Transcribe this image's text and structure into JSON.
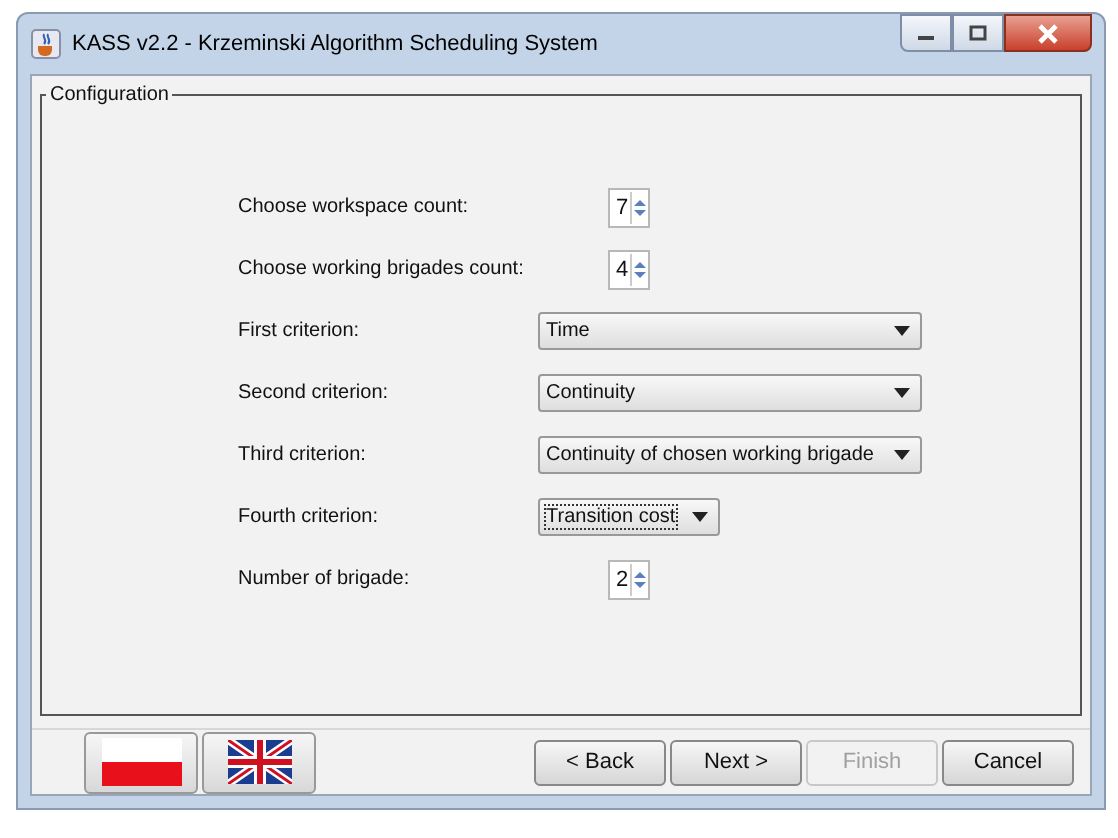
{
  "window": {
    "title": "KASS v2.2 - Krzeminski Algorithm Scheduling System"
  },
  "panel": {
    "title": "Configuration"
  },
  "rows": [
    {
      "kind": "spinner",
      "label": "Choose workspace count:",
      "value": "7"
    },
    {
      "kind": "spinner",
      "label": "Choose working brigades count:",
      "value": "4"
    },
    {
      "kind": "combo",
      "label": "First criterion:",
      "value": "Time",
      "focused": false
    },
    {
      "kind": "combo",
      "label": "Second criterion:",
      "value": "Continuity",
      "focused": false
    },
    {
      "kind": "combo",
      "label": "Third criterion:",
      "value": "Continuity of chosen working brigade",
      "focused": false
    },
    {
      "kind": "combo",
      "label": "Fourth criterion:",
      "value": "Transition cost",
      "focused": true
    },
    {
      "kind": "spinner",
      "label": "Number of brigade:",
      "value": "2"
    }
  ],
  "languages": [
    {
      "kind": "pl"
    },
    {
      "kind": "gb"
    }
  ],
  "buttons": [
    {
      "label": "< Back",
      "disabled": false
    },
    {
      "label": "Next >",
      "disabled": false
    },
    {
      "label": "Finish",
      "disabled": true
    },
    {
      "label": "Cancel",
      "disabled": false
    }
  ]
}
